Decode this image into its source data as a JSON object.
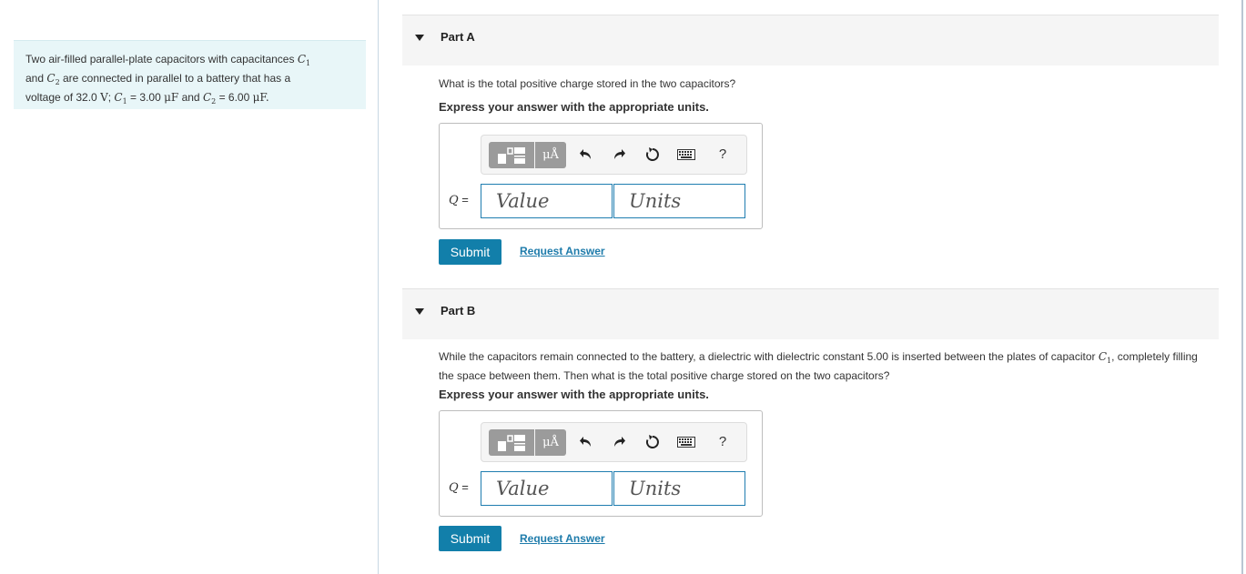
{
  "problem": {
    "line1_text": "Two air-filled parallel-plate capacitors with capacitances",
    "c1_symbol": "C",
    "c1_sub": "1",
    "line2_and": "and",
    "c2_symbol": "C",
    "c2_sub": "2",
    "line2_text": "are connected in parallel to a battery that has a",
    "line3_prefix": "voltage of 32.0",
    "volt_unit": "V",
    "c1_value": "= 3.00",
    "mu_f": "μF",
    "and_word": "and",
    "c2_value": "= 6.00",
    "mu_f2": "μF."
  },
  "parts": [
    {
      "title": "Part A",
      "question": "What is the total positive charge stored in the two capacitors?",
      "instruction": "Express your answer with the appropriate units.",
      "q_symbol": "Q",
      "equals": "=",
      "value_placeholder": "Value",
      "units_placeholder": "Units",
      "units_button": "μÅ",
      "help": "?",
      "submit_label": "Submit",
      "request_label": "Request Answer"
    },
    {
      "title": "Part B",
      "question_prefix": "While the capacitors remain connected to the battery, a dielectric with dielectric constant 5.00 is inserted between the plates of capacitor",
      "question_c1": "C",
      "question_c1_sub": "1",
      "question_suffix": ", completely filling the space between them. Then what is the total positive charge stored on the two capacitors?",
      "instruction": "Express your answer with the appropriate units.",
      "q_symbol": "Q",
      "equals": "=",
      "value_placeholder": "Value",
      "units_placeholder": "Units",
      "units_button": "μÅ",
      "help": "?",
      "submit_label": "Submit",
      "request_label": "Request Answer"
    }
  ],
  "colors": {
    "problem_bg": "#e8f6f8",
    "accent": "#127faa",
    "link": "#1f7cab",
    "input_border": "#1f7db0"
  },
  "icons": [
    "template-icon",
    "units-icon",
    "undo-icon",
    "redo-icon",
    "reset-icon",
    "keyboard-icon",
    "help-icon"
  ]
}
